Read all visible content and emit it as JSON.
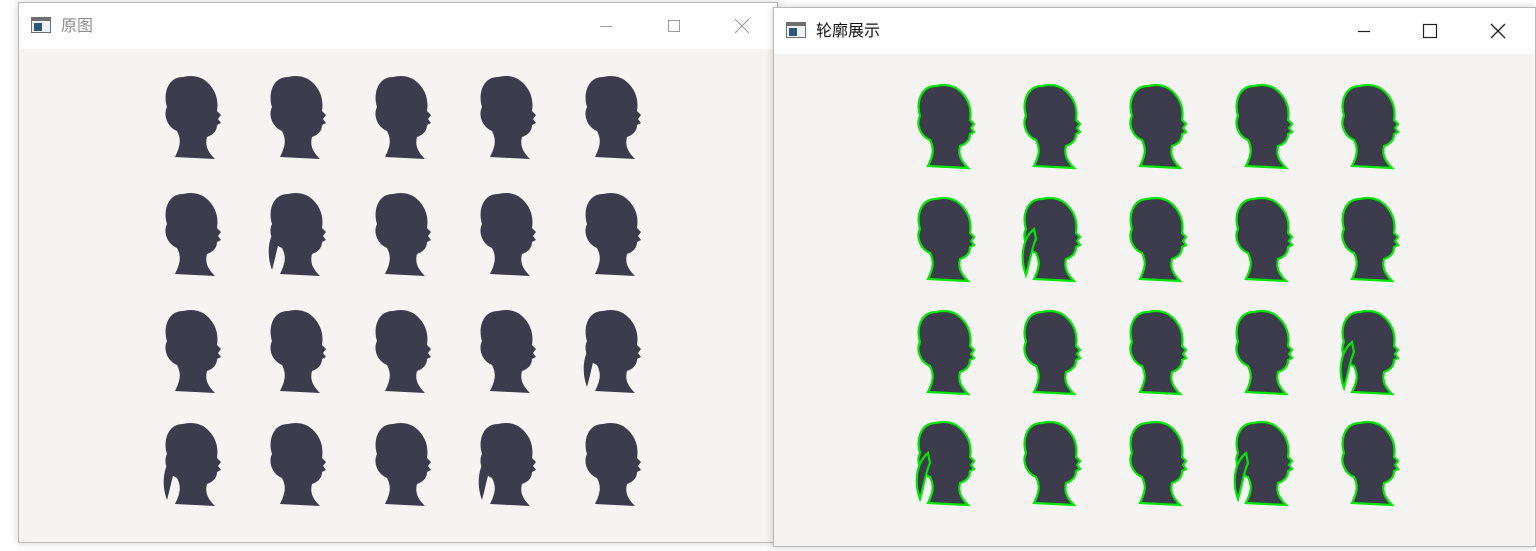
{
  "windows": [
    {
      "id": "left",
      "title": "原图",
      "controls": [
        "minimize-icon",
        "maximize-icon",
        "close-icon"
      ],
      "image": {
        "description_free": true,
        "rows": 4,
        "cols": 5,
        "silhouette_color": "#3c3c4c",
        "contour_color": null
      }
    },
    {
      "id": "right",
      "title": "轮廓展示",
      "controls": [
        "minimize-icon",
        "maximize-icon",
        "close-icon"
      ],
      "image": {
        "rows": 4,
        "cols": 5,
        "silhouette_color": "#3c3c4c",
        "contour_color": "#00e600"
      }
    }
  ],
  "colors": {
    "canvas_background": "#f5f4f3",
    "titlebar_background": "#ffffff",
    "inactive_title_text": "#8e8e8e",
    "active_title_text": "#111111"
  }
}
